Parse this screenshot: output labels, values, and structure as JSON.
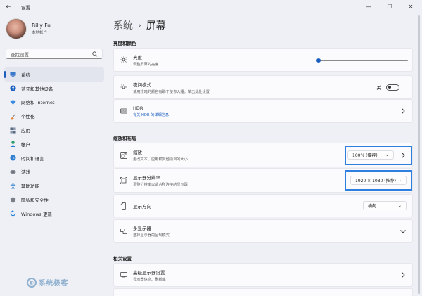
{
  "window": {
    "title": "设置",
    "minimize_glyph": "—",
    "maximize_glyph": "☐",
    "close_glyph": "✕"
  },
  "profile": {
    "name": "Billy Fu",
    "account_type": "本地帐户"
  },
  "search": {
    "placeholder": "查找设置"
  },
  "sidebar": {
    "items": [
      {
        "label": "系统",
        "icon": "system-icon",
        "active": true,
        "color": "#3a78c9"
      },
      {
        "label": "蓝牙和其他设备",
        "icon": "bluetooth-icon",
        "active": false,
        "color": "#1a5fbf"
      },
      {
        "label": "网络和 Internet",
        "icon": "network-icon",
        "active": false,
        "color": "#3a8be0"
      },
      {
        "label": "个性化",
        "icon": "personalization-icon",
        "active": false,
        "color": "#e08a3a"
      },
      {
        "label": "应用",
        "icon": "apps-icon",
        "active": false,
        "color": "#5a6a82"
      },
      {
        "label": "帐户",
        "icon": "accounts-icon",
        "active": false,
        "color": "#2e9c6a"
      },
      {
        "label": "时间和语言",
        "icon": "time-language-icon",
        "active": false,
        "color": "#2e7fd0"
      },
      {
        "label": "游戏",
        "icon": "gaming-icon",
        "active": false,
        "color": "#6a6f7a"
      },
      {
        "label": "辅助功能",
        "icon": "accessibility-icon",
        "active": false,
        "color": "#2577c9"
      },
      {
        "label": "隐私和安全性",
        "icon": "privacy-icon",
        "active": false,
        "color": "#7a7f8a"
      },
      {
        "label": "Windows 更新",
        "icon": "windows-update-icon",
        "active": false,
        "color": "#1a7fd8"
      }
    ]
  },
  "breadcrumb": {
    "root": "系统",
    "separator": "›",
    "current": "屏幕"
  },
  "sections": {
    "brightness_color": "亮度和颜色",
    "scale_layout": "缩放和布局",
    "related": "相关设置"
  },
  "cards": {
    "brightness": {
      "title": "亮度",
      "desc": "调整屏幕的亮度",
      "value_fraction": 0.0
    },
    "night_light": {
      "title": "夜间模式",
      "desc": "使用较暗的颜色有助于使你入睡。单击此处设置",
      "toggle_label": "关",
      "toggle_on": false
    },
    "hdr": {
      "title": "HDR",
      "desc": "有关 HDR 的详细信息"
    },
    "scale": {
      "title": "缩放",
      "desc": "更改文本、应用和其他项目的大小",
      "value": "100% (推荐)"
    },
    "resolution": {
      "title": "显示器分辨率",
      "desc": "调整分辨率以适合所连接的显示器",
      "value": "1920 × 1080 (推荐)"
    },
    "orientation": {
      "title": "显示方向",
      "value": "横向"
    },
    "multi_display": {
      "title": "多显示器",
      "desc": "选择显示器的呈现模式"
    },
    "advanced_display": {
      "title": "高级显示器设置",
      "desc": "显示器信息、刷新率"
    }
  },
  "watermark": {
    "text": "系统极客"
  },
  "colors": {
    "accent": "#1a5fbf",
    "highlight_box": "#2f7fe0",
    "background": "#eef0f6",
    "card": "#fbfbfd"
  }
}
